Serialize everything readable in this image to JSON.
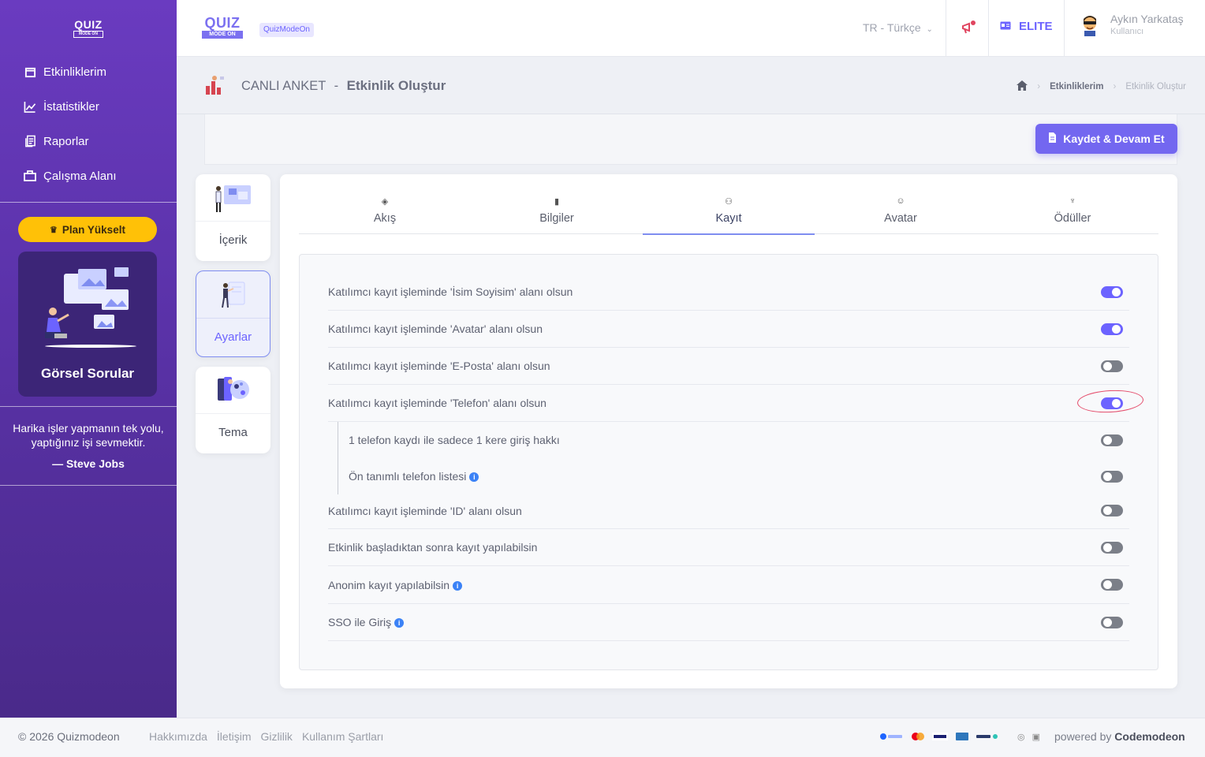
{
  "sidebar": {
    "logo": {
      "word": "QUIZ",
      "sub": "MODE ON"
    },
    "items": [
      {
        "label": "Etkinliklerim",
        "icon": "calendar-icon"
      },
      {
        "label": "İstatistikler",
        "icon": "chart-line-icon"
      },
      {
        "label": "Raporlar",
        "icon": "document-icon"
      },
      {
        "label": "Çalışma Alanı",
        "icon": "briefcase-icon"
      }
    ],
    "plan_button": "Plan Yükselt",
    "promo_title": "Görsel Sorular",
    "quote": "Harika işler yapmanın tek yolu, yaptığınız işi sevmektir.",
    "quote_author": "— Steve Jobs"
  },
  "header": {
    "logo": {
      "word": "QUIZ",
      "sub": "MODE ON"
    },
    "badge": "QuizModeOn",
    "language": "TR - Türkçe",
    "plan": "ELITE",
    "user_name": "Aykın Yarkataş",
    "user_role": "Kullanıcı"
  },
  "titlebar": {
    "type": "CANLI ANKET",
    "separator": "-",
    "title": "Etkinlik Oluştur",
    "breadcrumb": [
      "Etkinliklerim",
      "Etkinlik Oluştur"
    ]
  },
  "save_button": "Kaydet & Devam Et",
  "left_cards": [
    {
      "label": "İçerik"
    },
    {
      "label": "Ayarlar"
    },
    {
      "label": "Tema"
    }
  ],
  "tabs": [
    {
      "label": "Akış",
      "icon": "layers-icon"
    },
    {
      "label": "Bilgiler",
      "icon": "book-icon"
    },
    {
      "label": "Kayıt",
      "icon": "users-icon"
    },
    {
      "label": "Avatar",
      "icon": "face-icon"
    },
    {
      "label": "Ödüller",
      "icon": "trophy-icon"
    }
  ],
  "active_tab": "Kayıt",
  "settings": [
    {
      "label": "Katılımcı kayıt işleminde 'İsim Soyisim' alanı olsun",
      "on": true
    },
    {
      "label": "Katılımcı kayıt işleminde 'Avatar' alanı olsun",
      "on": true
    },
    {
      "label": "Katılımcı kayıt işleminde 'E-Posta' alanı olsun",
      "on": false
    },
    {
      "label": "Katılımcı kayıt işleminde 'Telefon' alanı olsun",
      "on": true
    },
    {
      "label": "1 telefon kaydı ile sadece 1 kere giriş hakkı",
      "on": false
    },
    {
      "label": "Ön tanımlı telefon listesi",
      "on": false,
      "info": true
    },
    {
      "label": "Katılımcı kayıt işleminde 'ID' alanı olsun",
      "on": false
    },
    {
      "label": "Etkinlik başladıktan sonra kayıt yapılabilsin",
      "on": false
    },
    {
      "label": "Anonim kayıt yapılabilsin",
      "on": false,
      "info": true
    },
    {
      "label": "SSO ile Giriş",
      "on": false,
      "info": true
    }
  ],
  "footer": {
    "copyright": "© 2026 Quizmodeon",
    "links": [
      "Hakkımızda",
      "İletişim",
      "Gizlilik",
      "Kullanım Şartları"
    ],
    "powered_prefix": "powered by",
    "powered_brand": "Codemodeon"
  },
  "colors": {
    "accent": "#7367f0",
    "sidebar": "#5a32a8",
    "plan": "#ffc107",
    "annotation": "#e44b6a"
  }
}
